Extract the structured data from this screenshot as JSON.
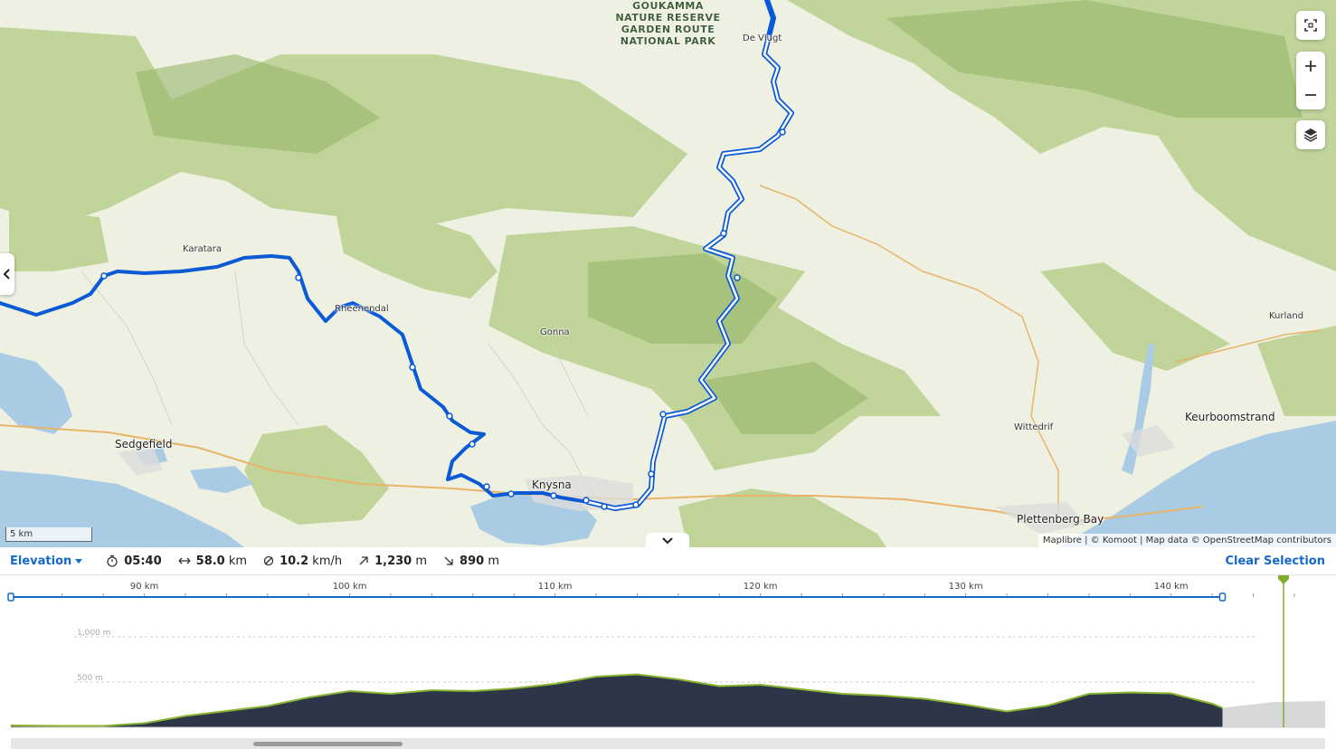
{
  "map": {
    "places": [
      {
        "id": "de-vlugt",
        "label": "De Vlugt",
        "cls": "place"
      },
      {
        "id": "karatara",
        "label": "Karatara",
        "cls": "place"
      },
      {
        "id": "rheenendal",
        "label": "Rheenendal",
        "cls": "place"
      },
      {
        "id": "gonna",
        "label": "Gonna",
        "cls": "place"
      },
      {
        "id": "sedgefield",
        "label": "Sedgefield",
        "cls": "town"
      },
      {
        "id": "knysna",
        "label": "Knysna",
        "cls": "town"
      },
      {
        "id": "wittedrif",
        "label": "Wittedrif",
        "cls": "place"
      },
      {
        "id": "plettenberg-bay",
        "label": "Plettenberg Bay",
        "cls": "town"
      },
      {
        "id": "keurboomstrand",
        "label": "Keurboomstrand",
        "cls": "town"
      },
      {
        "id": "kurland",
        "label": "Kurland",
        "cls": "place"
      }
    ],
    "parks": {
      "goukamma": "GOUKAMMA\nNATURE RESERVE",
      "garden_route": "GARDEN ROUTE\nNATIONAL PARK"
    },
    "scale_label": "5 km",
    "attribution": "Maplibre | © Komoot | Map data © OpenStreetMap contributors",
    "controls": [
      "fullscreen-icon",
      "zoom-in-icon",
      "zoom-out-icon",
      "layers-icon"
    ],
    "colors": {
      "route": "#0a5ad6",
      "water": "#a9cce4",
      "forest": "#a9c47a",
      "land": "#eef0e1"
    }
  },
  "panel": {
    "mode_label": "Elevation",
    "duration": "05:40",
    "distance_value": "58.0",
    "distance_unit": "km",
    "speed_value": "10.2",
    "speed_unit": "km/h",
    "ascent_value": "1,230",
    "ascent_unit": "m",
    "descent_value": "890",
    "descent_unit": "m",
    "clear_label": "Clear Selection"
  },
  "chart_data": {
    "type": "area",
    "title": "",
    "xlabel": "",
    "ylabel": "",
    "x_ticks": [
      "90 km",
      "100 km",
      "110 km",
      "120 km",
      "130 km",
      "140 km"
    ],
    "y_ticks": [
      "500 m",
      "1,000 m"
    ],
    "xlim": [
      83.5,
      147.5
    ],
    "ylim": [
      0,
      1000
    ],
    "selection_km": [
      83.5,
      142.5
    ],
    "x": [
      83.5,
      86,
      88,
      90,
      92,
      94,
      96,
      98,
      100,
      102,
      104,
      106,
      108,
      110,
      112,
      114,
      116,
      118,
      120,
      122,
      124,
      126,
      128,
      130,
      132,
      134,
      136,
      138,
      140,
      142,
      142.5
    ],
    "y": [
      20,
      15,
      15,
      45,
      125,
      180,
      235,
      330,
      400,
      370,
      410,
      400,
      430,
      480,
      560,
      585,
      530,
      455,
      470,
      420,
      370,
      350,
      315,
      250,
      175,
      240,
      370,
      385,
      375,
      260,
      215
    ],
    "colors": {
      "fill": "#2c3648",
      "line": "#88b331",
      "grid": "#cccccc",
      "selection": "#1669c7"
    }
  }
}
